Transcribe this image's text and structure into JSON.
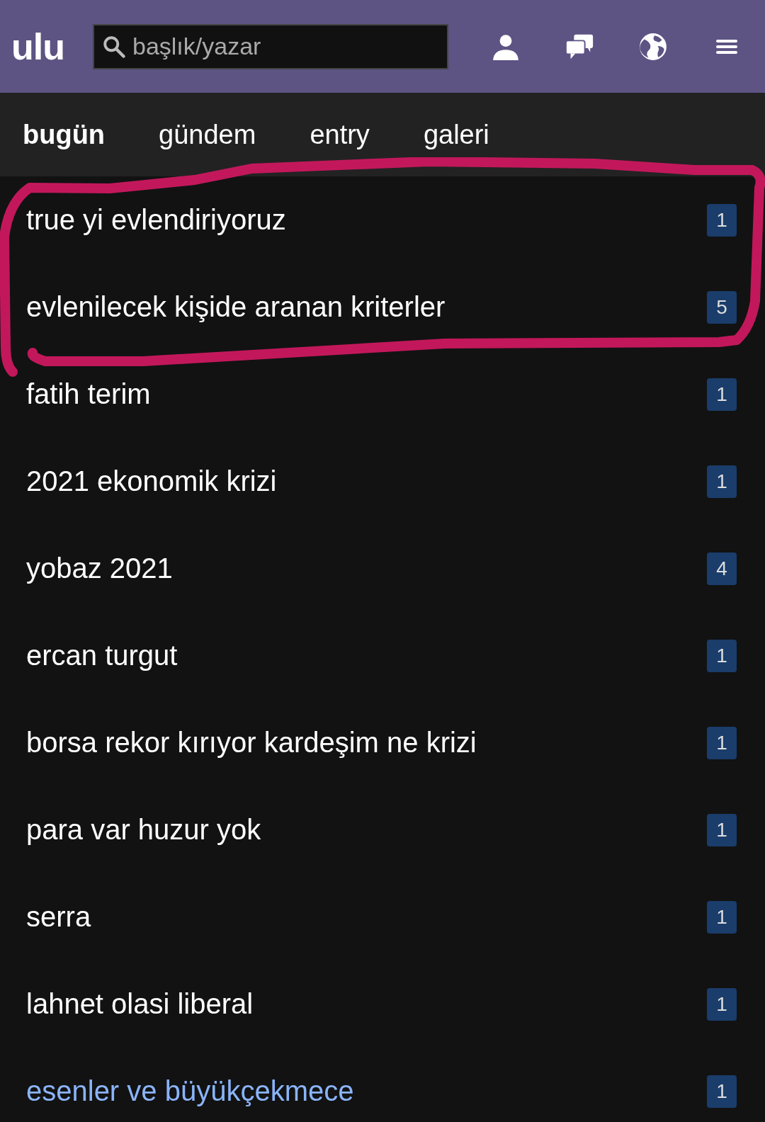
{
  "header": {
    "logo": "ulu",
    "search": {
      "placeholder": "başlık/yazar"
    }
  },
  "tabs": [
    {
      "label": "bugün",
      "selected": true
    },
    {
      "label": "gündem",
      "selected": false
    },
    {
      "label": "entry",
      "selected": false
    },
    {
      "label": "galeri",
      "selected": false
    }
  ],
  "topics": [
    {
      "title": "true yi evlendiriyoruz",
      "count": "1",
      "visited": false
    },
    {
      "title": "evlenilecek kişide aranan kriterler",
      "count": "5",
      "visited": false
    },
    {
      "title": "fatih terim",
      "count": "1",
      "visited": false
    },
    {
      "title": "2021 ekonomik krizi",
      "count": "1",
      "visited": false
    },
    {
      "title": "yobaz 2021",
      "count": "4",
      "visited": false
    },
    {
      "title": "ercan turgut",
      "count": "1",
      "visited": false
    },
    {
      "title": "borsa rekor kırıyor kardeşim ne krizi",
      "count": "1",
      "visited": false
    },
    {
      "title": "para var huzur yok",
      "count": "1",
      "visited": false
    },
    {
      "title": "serra",
      "count": "1",
      "visited": false
    },
    {
      "title": "lahnet olasi liberal",
      "count": "1",
      "visited": false
    },
    {
      "title": "esenler ve büyükçekmece",
      "count": "1",
      "visited": true
    }
  ],
  "annotation": {
    "color": "#c2185b"
  }
}
